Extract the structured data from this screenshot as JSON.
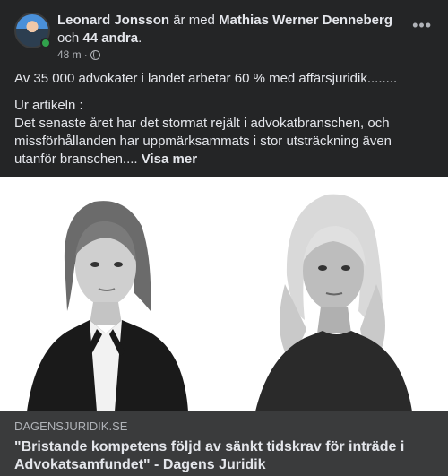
{
  "post": {
    "author": "Leonard Jonsson",
    "with_word": " är med ",
    "tagged": "Mathias Werner Denneberg",
    "and_word": " och ",
    "others": "44 andra",
    "period": ".",
    "time": "48 m",
    "dot": "·",
    "privacy_icon": "globe-icon",
    "more_icon": "more-options-icon",
    "line1": "Av 35 000 advokater i landet arbetar 60 % med affärsjuridik........",
    "line2": "Ur artikeln :",
    "line3": "Det senaste året har det stormat rejält i advokatbranschen, och missförhållanden har uppmärksammats i stor utsträckning även utanför branschen.... ",
    "see_more": "Visa mer"
  },
  "link": {
    "domain": "DAGENSJURIDIK.SE",
    "title": "\"Bristande kompetens följd av sänkt tidskrav för inträde i Advokatsamfundet\" - Dagens Juridik"
  },
  "colors": {
    "background": "#242526",
    "link_meta_bg": "#3a3b3c",
    "primary_text": "#e4e6eb",
    "secondary_text": "#b0b3b8",
    "online": "#31a24c"
  }
}
